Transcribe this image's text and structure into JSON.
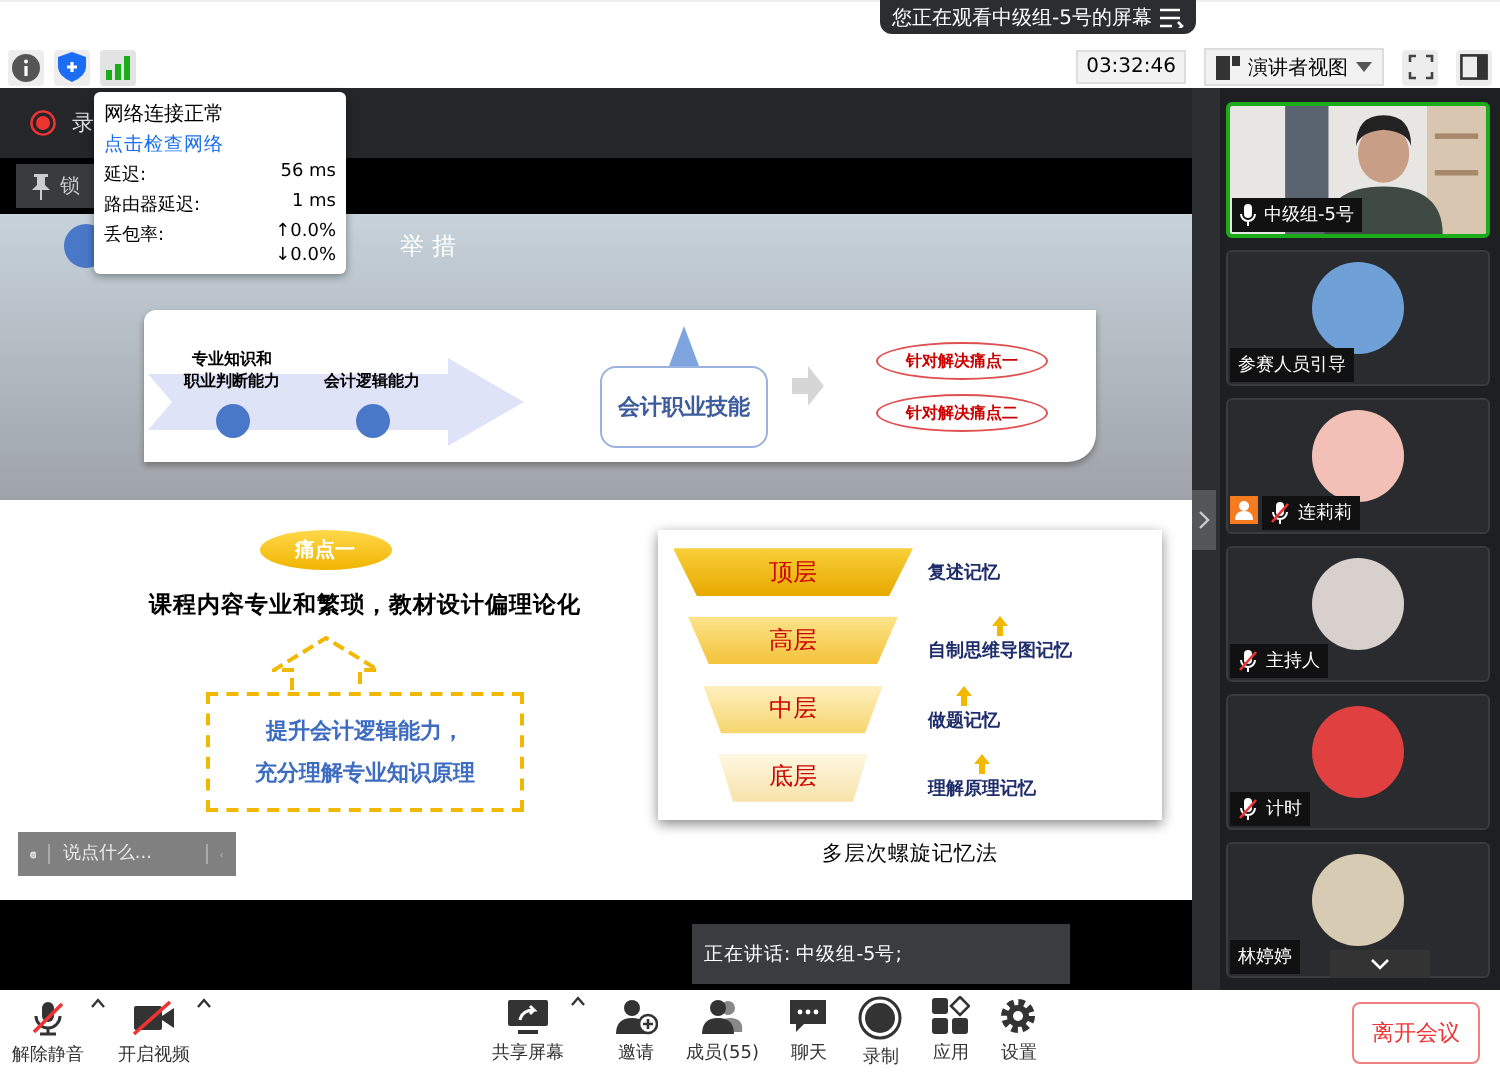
{
  "banner": {
    "text": "您正在观看中级组-5号的屏幕"
  },
  "toolbar": {
    "time": "03:32:46",
    "view_button": "演讲者视图"
  },
  "network_popup": {
    "status": "网络连接正常",
    "link": "点击检查网络",
    "rows": [
      {
        "label": "延迟:",
        "values": [
          "56 ms"
        ]
      },
      {
        "label": "路由器延迟:",
        "values": [
          "1 ms"
        ]
      },
      {
        "label": "丢包率:",
        "values": [
          "↑0.0%",
          "↓0.0%"
        ]
      }
    ]
  },
  "share_bar": {
    "recording_label": "录",
    "lock_label": "锁"
  },
  "slide": {
    "title": "举 措",
    "flow": {
      "steps": [
        {
          "lines": [
            "专业知识和",
            "职业判断能力"
          ]
        },
        {
          "lines": [
            "会计逻辑能力"
          ]
        }
      ],
      "skill": "会计职业技能",
      "results": [
        "针对解决痛点一",
        "针对解决痛点二"
      ]
    },
    "pain_badge": "痛点一",
    "statement": "课程内容专业和繁琐，教材设计偏理论化",
    "measures": [
      "提升**会计逻辑能力**，",
      "充分理解**专业知识**原理"
    ],
    "pyramid": [
      {
        "label": "顶层",
        "note": "复述记忆"
      },
      {
        "label": "高层",
        "note": "自制思维导图记忆"
      },
      {
        "label": "中层",
        "note": "做题记忆"
      },
      {
        "label": "底层",
        "note": "理解原理记忆"
      }
    ],
    "caption": "多层次螺旋记忆法"
  },
  "chat_input": {
    "placeholder": "说点什么..."
  },
  "speaking": "正在讲话: 中级组-5号;",
  "participants": [
    {
      "name": "中级组-5号",
      "kind": "video",
      "muted": false,
      "active": true,
      "host": false
    },
    {
      "name": "参赛人员引导",
      "kind": "avatar",
      "active": false,
      "host": false
    },
    {
      "name": "连莉莉",
      "kind": "avatar",
      "muted": true,
      "active": false,
      "host": true
    },
    {
      "name": "主持人",
      "kind": "avatar",
      "muted": true,
      "active": false,
      "host": false
    },
    {
      "name": "计时",
      "kind": "avatar",
      "muted": true,
      "active": false,
      "host": false
    },
    {
      "name": "林婷婷",
      "kind": "avatar",
      "active": false,
      "host": false
    }
  ],
  "bottom_bar": {
    "left": [
      {
        "label": "解除静音",
        "kind": "mic-off",
        "menu": true
      },
      {
        "label": "开启视频",
        "kind": "camera-off",
        "menu": true
      }
    ],
    "center": [
      {
        "label": "共享屏幕",
        "kind": "share",
        "menu": true
      },
      {
        "label": "邀请",
        "kind": "invite",
        "menu": false
      },
      {
        "label": "成员(55)",
        "kind": "members",
        "menu": false
      },
      {
        "label": "聊天",
        "kind": "chat",
        "menu": false
      },
      {
        "label": "录制",
        "kind": "record",
        "menu": false
      },
      {
        "label": "应用",
        "kind": "apps",
        "menu": false
      },
      {
        "label": "设置",
        "kind": "settings",
        "menu": false
      }
    ],
    "leave": "离开会议"
  }
}
